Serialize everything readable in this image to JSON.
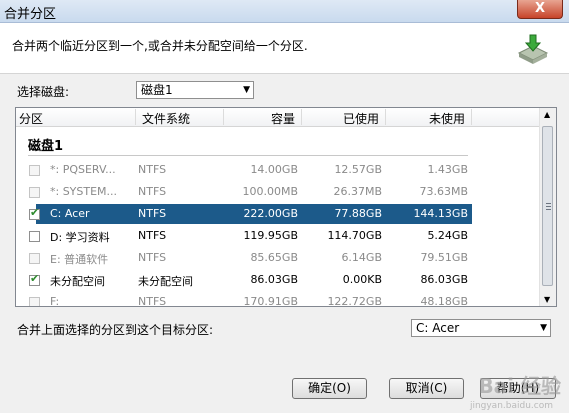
{
  "window": {
    "title": "合并分区",
    "close_label": "X"
  },
  "header": {
    "description": "合并两个临近分区到一个,或合并未分配空间给一个分区."
  },
  "disk_select": {
    "label": "选择磁盘:",
    "value": "磁盘1"
  },
  "table": {
    "columns": [
      "分区",
      "文件系统",
      "容量",
      "已使用",
      "未使用"
    ],
    "group": "磁盘1",
    "rows": [
      {
        "name": "*:  PQSERV...",
        "fs": "NTFS",
        "capacity": "14.00GB",
        "used": "12.57GB",
        "unused": "1.43GB",
        "checked": false,
        "enabled": false,
        "selected": false
      },
      {
        "name": "*:  SYSTEM...",
        "fs": "NTFS",
        "capacity": "100.00MB",
        "used": "26.37MB",
        "unused": "73.63MB",
        "checked": false,
        "enabled": false,
        "selected": false
      },
      {
        "name": "C:  Acer",
        "fs": "NTFS",
        "capacity": "222.00GB",
        "used": "77.88GB",
        "unused": "144.13GB",
        "checked": true,
        "enabled": true,
        "selected": true
      },
      {
        "name": "D:  学习资料",
        "fs": "NTFS",
        "capacity": "119.95GB",
        "used": "114.70GB",
        "unused": "5.24GB",
        "checked": false,
        "enabled": true,
        "selected": false
      },
      {
        "name": "E:  普通软件",
        "fs": "NTFS",
        "capacity": "85.65GB",
        "used": "6.14GB",
        "unused": "79.51GB",
        "checked": false,
        "enabled": false,
        "selected": false
      },
      {
        "name": "未分配空间",
        "fs": "未分配空间",
        "capacity": "86.03GB",
        "used": "0.00KB",
        "unused": "86.03GB",
        "checked": true,
        "enabled": true,
        "selected": false
      },
      {
        "name": "F:",
        "fs": "NTFS",
        "capacity": "170.91GB",
        "used": "122.72GB",
        "unused": "48.18GB",
        "checked": false,
        "enabled": false,
        "selected": false
      }
    ]
  },
  "target": {
    "label": "合并上面选择的分区到这个目标分区:",
    "value": "C:  Acer"
  },
  "buttons": {
    "ok": "确定(O)",
    "cancel": "取消(C)",
    "help": "帮助(H)"
  },
  "watermark": {
    "text": "Bai 经验",
    "sub": "jingyan.baidu.com"
  }
}
